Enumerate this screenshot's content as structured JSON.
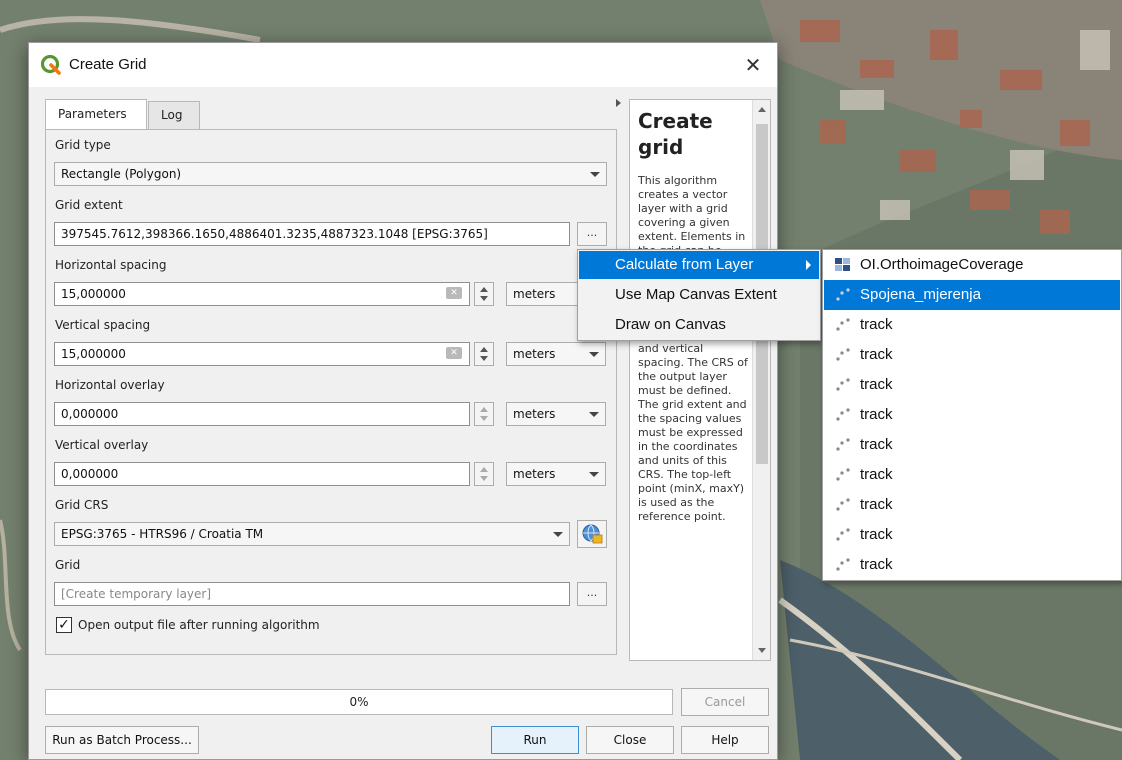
{
  "window": {
    "title": "Create Grid",
    "close_glyph": "✕"
  },
  "tabs": [
    {
      "label": "Parameters",
      "active": true
    },
    {
      "label": "Log",
      "active": false
    }
  ],
  "params": {
    "grid_type_label": "Grid type",
    "grid_type_value": "Rectangle (Polygon)",
    "grid_extent_label": "Grid extent",
    "grid_extent_value": "397545.7612,398366.1650,4886401.3235,4887323.1048 [EPSG:3765]",
    "h_spacing_label": "Horizontal spacing",
    "h_spacing_value": "15,000000",
    "h_spacing_unit": "meters",
    "v_spacing_label": "Vertical spacing",
    "v_spacing_value": "15,000000",
    "v_spacing_unit": "meters",
    "h_overlay_label": "Horizontal overlay",
    "h_overlay_value": "0,000000",
    "h_overlay_unit": "meters",
    "v_overlay_label": "Vertical overlay",
    "v_overlay_value": "0,000000",
    "v_overlay_unit": "meters",
    "crs_label": "Grid CRS",
    "crs_value": "EPSG:3765 - HTRS96 / Croatia TM",
    "output_label": "Grid",
    "output_placeholder": "[Create temporary layer]",
    "open_output_label": "Open output file after running algorithm",
    "open_output_checked": true,
    "dots_label": "..."
  },
  "help": {
    "title": "Create grid",
    "body": "This algorithm creates a vector layer with a grid covering a given extent. Elements in the grid can be points, lines or polygons. The size and/or placement of each element in the grid is defined using a horizontal and vertical spacing. The CRS of the output layer must be defined. The grid extent and the spacing values must be expressed in the coordinates and units of this CRS. The top-left point (minX, maxY) is used as the reference point."
  },
  "progress": {
    "text": "0%",
    "value": 0
  },
  "buttons": {
    "batch": "Run as Batch Process...",
    "run": "Run",
    "close": "Close",
    "help": "Help",
    "cancel": "Cancel"
  },
  "extent_menu": [
    {
      "label": "Calculate from Layer",
      "highlighted": true,
      "has_submenu": true
    },
    {
      "label": "Use Map Canvas Extent",
      "highlighted": false,
      "has_submenu": false
    },
    {
      "label": "Draw on Canvas",
      "highlighted": false,
      "has_submenu": false
    }
  ],
  "layer_menu": [
    {
      "label": "OI.OrthoimageCoverage",
      "icon": "raster-layer-icon",
      "highlighted": false
    },
    {
      "label": "Spojena_mjerenja",
      "icon": "point-layer-icon",
      "highlighted": true
    },
    {
      "label": "track",
      "icon": "point-layer-icon",
      "highlighted": false
    },
    {
      "label": "track",
      "icon": "point-layer-icon",
      "highlighted": false
    },
    {
      "label": "track",
      "icon": "point-layer-icon",
      "highlighted": false
    },
    {
      "label": "track",
      "icon": "point-layer-icon",
      "highlighted": false
    },
    {
      "label": "track",
      "icon": "point-layer-icon",
      "highlighted": false
    },
    {
      "label": "track",
      "icon": "point-layer-icon",
      "highlighted": false
    },
    {
      "label": "track",
      "icon": "point-layer-icon",
      "highlighted": false
    },
    {
      "label": "track",
      "icon": "point-layer-icon",
      "highlighted": false
    },
    {
      "label": "track",
      "icon": "point-layer-icon",
      "highlighted": false
    }
  ],
  "colors": {
    "accent": "#0078d7",
    "qgis_green": "#589632",
    "qgis_yellow": "#ee7913"
  }
}
